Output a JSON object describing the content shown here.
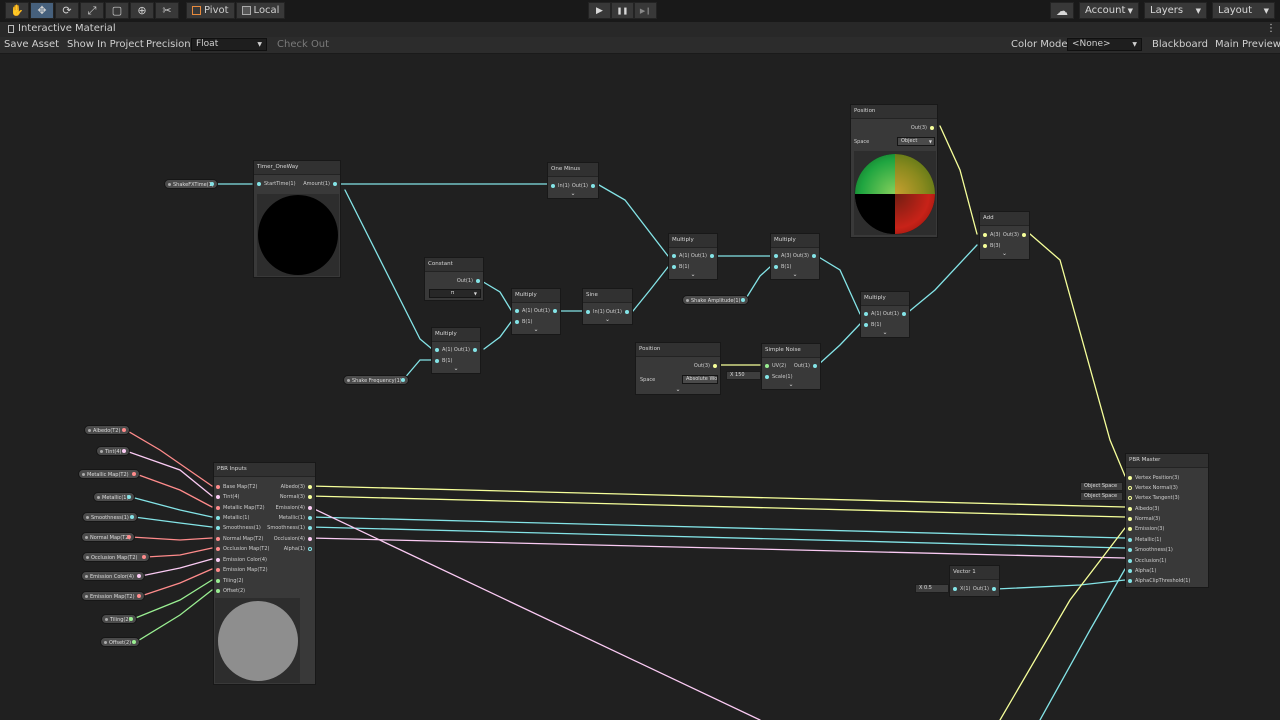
{
  "topbar": {
    "tools": [
      {
        "icon": "hand-tool-icon",
        "glyph": "✋"
      },
      {
        "icon": "move-tool-icon",
        "glyph": "✥"
      },
      {
        "icon": "rotate-tool-icon",
        "glyph": "⟳"
      },
      {
        "icon": "scale-tool-icon",
        "glyph": "⤢"
      },
      {
        "icon": "rect-tool-icon",
        "glyph": "▢"
      },
      {
        "icon": "transform-tool-icon",
        "glyph": "⊕"
      },
      {
        "icon": "custom-tool-icon",
        "glyph": "✂"
      }
    ],
    "pivot_label": "Pivot",
    "local_label": "Local",
    "play_glyph": "▶",
    "pause_glyph": "❚❚",
    "step_glyph": "▶❙",
    "cloud_glyph": "☁",
    "account_label": "Account",
    "layers_label": "Layers",
    "layout_label": "Layout"
  },
  "tab": {
    "title": "Interactive Material",
    "menu_glyph": "⋮"
  },
  "toolbar": {
    "save_asset": "Save Asset",
    "show_in_project": "Show In Project",
    "precision_label": "Precision",
    "precision_value": "Float",
    "check_out": "Check Out",
    "color_mode_label": "Color Mode",
    "color_mode_value": "<None>",
    "blackboard": "Blackboard",
    "main_preview": "Main Preview"
  },
  "colors": {
    "float": "#84e4e7",
    "vec3": "#f6ff9a",
    "vec4": "#fbcbf4",
    "tex": "#ff8b8b",
    "vec2": "#9aef92",
    "bool": "#9c9cff"
  },
  "graph": {
    "properties": {
      "shake_fx_time": "ShakeFXTime(1)",
      "shake_frequency": "Shake Frequency(1)",
      "shake_amplitude": "Shake Amplitude(1)",
      "albedo": "Albedo(T2)",
      "tint": "Tint(4)",
      "metallic_map": "Metallic Map(T2)",
      "metallic": "Metallic(1)",
      "smoothness": "Smoothness(1)",
      "normal_map": "Normal Map(T2)",
      "occlusion_map": "Occlusion Map(T2)",
      "emission_color": "Emission Color(4)",
      "emission_map": "Emission Map(T2)",
      "tiling": "Tiling(2)",
      "offset": "Offset(2)"
    },
    "timer": {
      "title": "Timer_OneWay",
      "in": "StartTime(1)",
      "out": "Amount(1)"
    },
    "one_minus": {
      "title": "One Minus",
      "in": "In(1)",
      "out": "Out(1)"
    },
    "constant": {
      "title": "Constant",
      "out": "Out(1)",
      "value": "π"
    },
    "multiply_a": {
      "title": "Multiply",
      "a": "A(1)",
      "b": "B(1)",
      "out": "Out(1)"
    },
    "multiply_b": {
      "title": "Multiply",
      "a": "A(1)",
      "b": "B(1)",
      "out": "Out(1)"
    },
    "sine": {
      "title": "Sine",
      "in": "In(1)",
      "out": "Out(1)"
    },
    "multiply_c": {
      "title": "Multiply",
      "a": "A(1)",
      "b": "B(1)",
      "out": "Out(1)"
    },
    "multiply_d": {
      "title": "Multiply",
      "a": "A(3)",
      "b": "B(1)",
      "out": "Out(3)"
    },
    "multiply_e": {
      "title": "Multiply",
      "a": "A(1)",
      "b": "B(1)",
      "out": "Out(1)"
    },
    "position_top": {
      "title": "Position",
      "out": "Out(3)",
      "space_label": "Space",
      "space_value": "Object"
    },
    "add": {
      "title": "Add",
      "a": "A(3)",
      "b": "B(3)",
      "out": "Out(3)"
    },
    "position_mid": {
      "title": "Position",
      "out": "Out(3)",
      "space_label": "Space",
      "space_value": "Absolute Wo"
    },
    "simple_noise": {
      "title": "Simple Noise",
      "uv": "UV(2)",
      "scale": "Scale(1)",
      "out": "Out(1)",
      "scale_axis": "X",
      "scale_value": "150"
    },
    "pbr_inputs": {
      "title": "PBR Inputs",
      "inputs": [
        "Base Map(T2)",
        "Tint(4)",
        "Metallic Map(T2)",
        "Metallic(1)",
        "Smoothness(1)",
        "Normal Map(T2)",
        "Occlusion Map(T2)",
        "Emission Color(4)",
        "Emission Map(T2)",
        "Tiling(2)",
        "Offset(2)"
      ],
      "outputs": [
        "Albedo(3)",
        "Normal(3)",
        "Emission(4)",
        "Metallic(1)",
        "Smoothness(1)",
        "Occlusion(4)",
        "Alpha(1)"
      ]
    },
    "pbr_master": {
      "title": "PBR Master",
      "inputs": [
        "Vertex Position(3)",
        "Vertex Normal(3)",
        "Vertex Tangent(3)",
        "Albedo(3)",
        "Normal(3)",
        "Emission(3)",
        "Metallic(1)",
        "Smoothness(1)",
        "Occlusion(1)",
        "Alpha(1)",
        "AlphaClipThreshold(1)"
      ],
      "space_tag": "Object Space"
    },
    "vector1": {
      "title": "Vector 1",
      "in": "X(1)",
      "out": "Out(1)",
      "axis": "X",
      "value": "0.5"
    }
  }
}
